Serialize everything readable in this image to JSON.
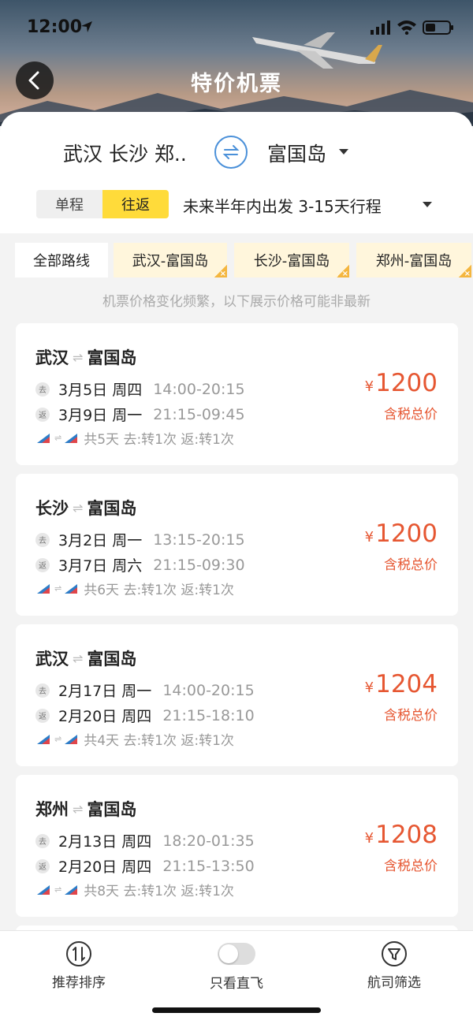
{
  "status_bar": {
    "time": "12:00"
  },
  "header": {
    "title": "特价机票"
  },
  "search": {
    "origin": "武汉 长沙 郑..",
    "destination": "富国岛",
    "trip_types": [
      "单程",
      "往返"
    ],
    "active_trip_type": "往返",
    "date_range": "未来半年内出发 3-15天行程"
  },
  "route_filters": [
    {
      "label": "全部路线"
    },
    {
      "label": "武汉-富国岛"
    },
    {
      "label": "长沙-富国岛"
    },
    {
      "label": "郑州-富国岛"
    }
  ],
  "notice": "机票价格变化频繁，以下展示价格可能非最新",
  "deals": [
    {
      "from": "武汉",
      "to": "富国岛",
      "outbound_badge": "去",
      "outbound_date": "3月5日 周四",
      "outbound_time": "14:00-20:15",
      "return_badge": "返",
      "return_date": "3月9日 周一",
      "return_time": "21:15-09:45",
      "summary": "共5天 去:转1次 返:转1次",
      "currency": "¥",
      "price": "1200",
      "price_label": "含税总价"
    },
    {
      "from": "长沙",
      "to": "富国岛",
      "outbound_badge": "去",
      "outbound_date": "3月2日 周一",
      "outbound_time": "13:15-20:15",
      "return_badge": "返",
      "return_date": "3月7日 周六",
      "return_time": "21:15-09:30",
      "summary": "共6天 去:转1次 返:转1次",
      "currency": "¥",
      "price": "1200",
      "price_label": "含税总价"
    },
    {
      "from": "武汉",
      "to": "富国岛",
      "outbound_badge": "去",
      "outbound_date": "2月17日 周一",
      "outbound_time": "14:00-20:15",
      "return_badge": "返",
      "return_date": "2月20日 周四",
      "return_time": "21:15-18:10",
      "summary": "共4天 去:转1次 返:转1次",
      "currency": "¥",
      "price": "1204",
      "price_label": "含税总价"
    },
    {
      "from": "郑州",
      "to": "富国岛",
      "outbound_badge": "去",
      "outbound_date": "2月13日 周四",
      "outbound_time": "18:20-01:35",
      "return_badge": "返",
      "return_date": "2月20日 周四",
      "return_time": "21:15-13:50",
      "summary": "共8天 去:转1次 返:转1次",
      "currency": "¥",
      "price": "1208",
      "price_label": "含税总价"
    }
  ],
  "bottom_bar": {
    "sort_label": "推荐排序",
    "direct_label": "只看直飞",
    "direct_enabled": false,
    "airline_filter_label": "航司筛选"
  },
  "colors": {
    "accent_yellow": "#ffdb3a",
    "price_red": "#e65732",
    "swap_blue": "#4a90d9"
  }
}
